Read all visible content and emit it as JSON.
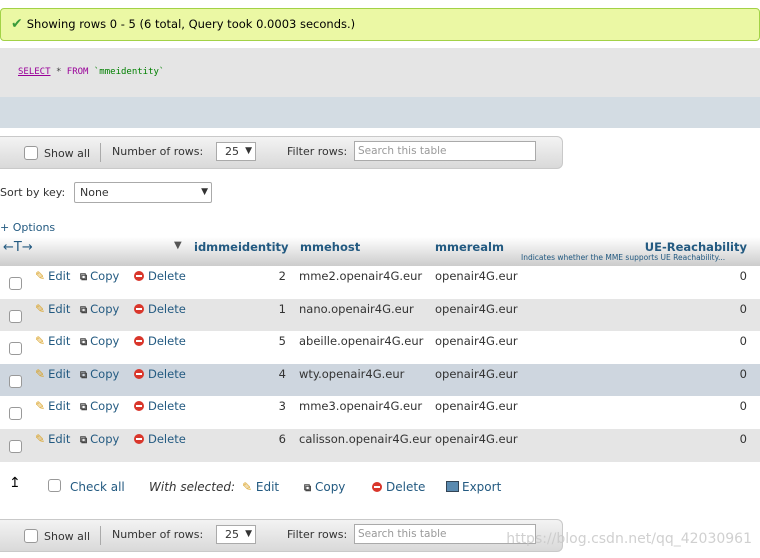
{
  "message": {
    "text": "Showing rows 0 - 5 (6 total, Query took 0.0003 seconds.)",
    "icon": "check-icon"
  },
  "sql": {
    "select_kw": "SELECT",
    "star": "*",
    "from_kw": "FROM",
    "table": "`mmeidentity`"
  },
  "navigation": {
    "show_all_label": "Show all",
    "number_of_rows_label": "Number of rows:",
    "rows_value": "25",
    "filter_label": "Filter rows:",
    "filter_placeholder": "Search this table"
  },
  "sort": {
    "label": "Sort by key:",
    "value": "None"
  },
  "options_label": "+ Options",
  "columns": {
    "arrows": "←T→",
    "col1": "idmmeidentity",
    "col2": "mmehost",
    "col3": "mmerealm",
    "col4": "UE-Reachability",
    "col4_desc": "Indicates whether the MME supports UE Reachability..."
  },
  "actions": {
    "edit": "Edit",
    "copy": "Copy",
    "delete": "Delete"
  },
  "rows": [
    {
      "id": "2",
      "host": "mme2.openair4G.eur",
      "realm": "openair4G.eur",
      "ue": "0"
    },
    {
      "id": "1",
      "host": "nano.openair4G.eur",
      "realm": "openair4G.eur",
      "ue": "0"
    },
    {
      "id": "5",
      "host": "abeille.openair4G.eur",
      "realm": "openair4G.eur",
      "ue": "0"
    },
    {
      "id": "4",
      "host": "wty.openair4G.eur",
      "realm": "openair4G.eur",
      "ue": "0"
    },
    {
      "id": "3",
      "host": "mme3.openair4G.eur",
      "realm": "openair4G.eur",
      "ue": "0"
    },
    {
      "id": "6",
      "host": "calisson.openair4G.eur",
      "realm": "openair4G.eur",
      "ue": "0"
    }
  ],
  "bulk": {
    "check_all": "Check all",
    "with_selected": "With selected:",
    "edit": "Edit",
    "copy": "Copy",
    "delete": "Delete",
    "export": "Export"
  },
  "watermark": "https://blog.csdn.net/qq_42030961"
}
